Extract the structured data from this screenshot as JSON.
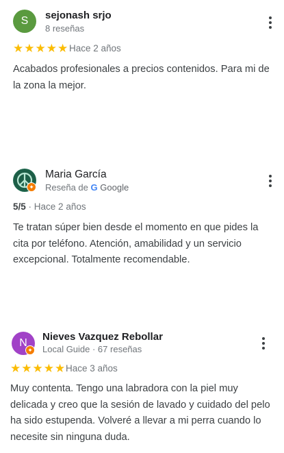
{
  "reviews": [
    {
      "author": "sejonash srjo",
      "avatar_letter": "S",
      "avatar_color": "#5a9a3f",
      "meta": "8 reseñas",
      "stars": 5,
      "time": "Hace 2 años",
      "text": "Acabados profesionales a precios contenidos. Para mi de la zona la mejor."
    },
    {
      "author": "Maria García",
      "avatar_icon": "peace-symbol-icon",
      "meta_prefix": "Reseña de",
      "meta_brand": "Google",
      "score": "5/5",
      "time": "· Hace 2 años",
      "text": "Te tratan súper bien desde el momento en que pides la cita por teléfono. Atención, amabilidad y un servicio excepcional. Totalmente recomendable."
    },
    {
      "author": "Nieves Vazquez Rebollar",
      "avatar_letter": "N",
      "avatar_color": "#a142c7",
      "meta": "Local Guide · 67 reseñas",
      "stars": 5,
      "time": "Hace 3 años",
      "text": "Muy contenta. Tengo una labradora con la piel muy delicada y creo que la sesión de lavado y cuidado del pelo ha sido estupenda. Volveré a llevar a mi perra cuando lo necesite sin ninguna duda."
    }
  ],
  "colors": {
    "star": "#fbbc04",
    "local_guide_badge": "#f57c00"
  }
}
